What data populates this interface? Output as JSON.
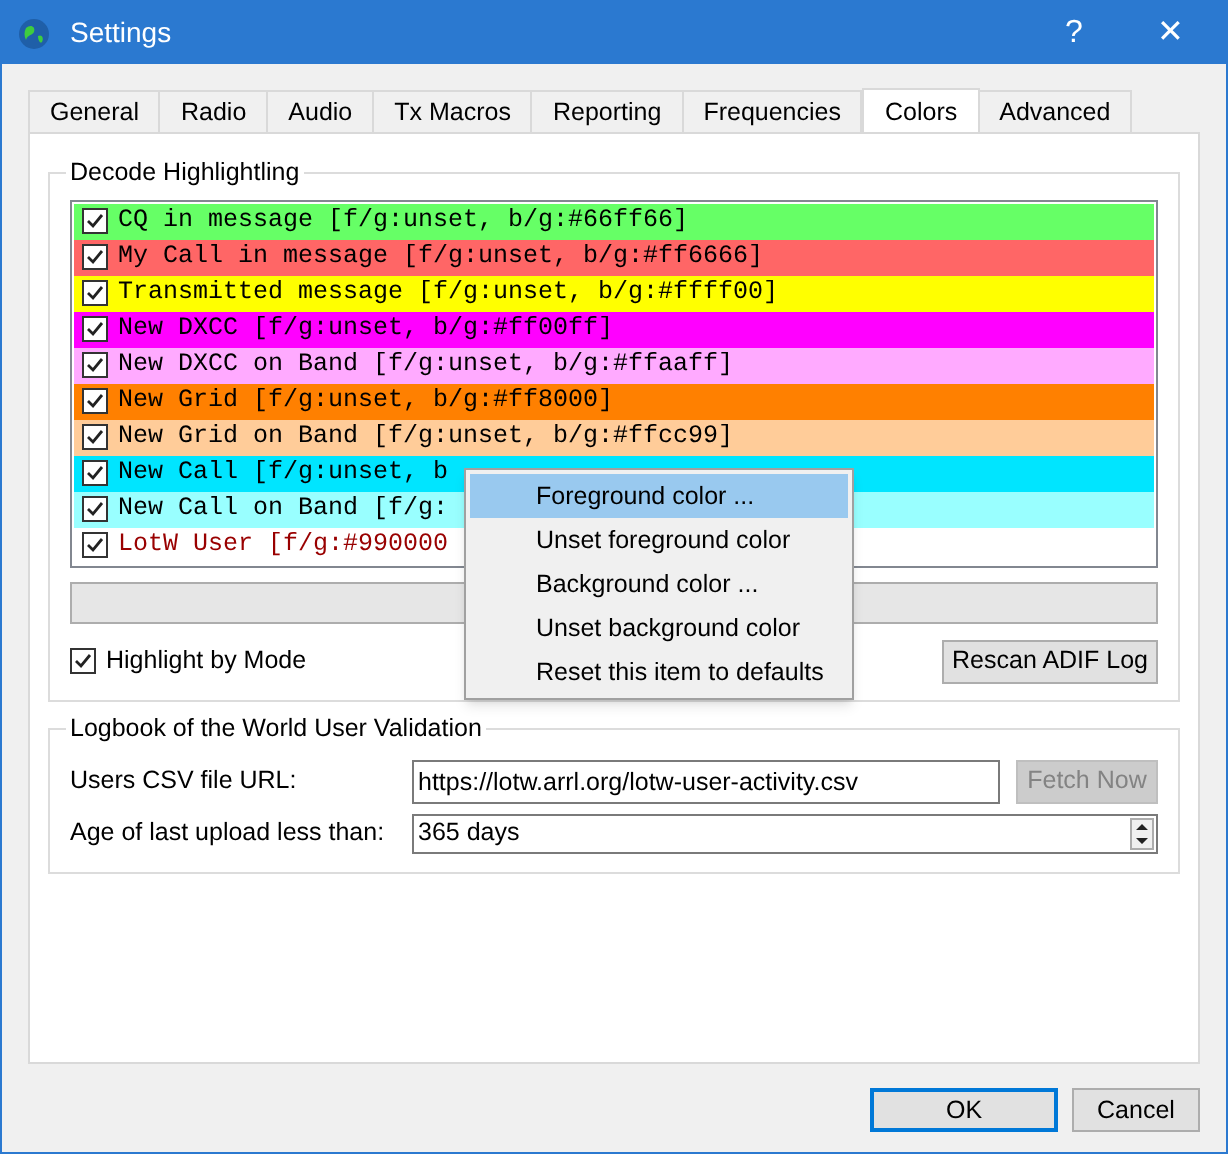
{
  "window": {
    "title": "Settings",
    "help": "?",
    "close": "✕"
  },
  "tabs": [
    {
      "label": "General",
      "selected": false
    },
    {
      "label": "Radio",
      "selected": false
    },
    {
      "label": "Audio",
      "selected": false
    },
    {
      "label": "Tx Macros",
      "selected": false
    },
    {
      "label": "Reporting",
      "selected": false
    },
    {
      "label": "Frequencies",
      "selected": false
    },
    {
      "label": "Colors",
      "selected": true
    },
    {
      "label": "Advanced",
      "selected": false
    }
  ],
  "decode_highlighting": {
    "title": "Decode Highlightling",
    "items": [
      {
        "label": "CQ in message [f/g:unset, b/g:#66ff66]",
        "checked": true,
        "color": "#66ff66"
      },
      {
        "label": "My Call in message [f/g:unset, b/g:#ff6666]",
        "checked": true,
        "color": "#ff6666"
      },
      {
        "label": "Transmitted message [f/g:unset, b/g:#ffff00]",
        "checked": true,
        "color": "#ffff00"
      },
      {
        "label": "New DXCC [f/g:unset, b/g:#ff00ff]",
        "checked": true,
        "color": "#ff00ff"
      },
      {
        "label": "New DXCC on Band [f/g:unset, b/g:#ffaaff]",
        "checked": true,
        "color": "#ffaaff"
      },
      {
        "label": "New Grid [f/g:unset, b/g:#ff8000]",
        "checked": true,
        "color": "#ff8000"
      },
      {
        "label": "New Grid on Band [f/g:unset, b/g:#ffcc99]",
        "checked": true,
        "color": "#ffcc99"
      },
      {
        "label": "New Call [f/g:unset, b",
        "checked": true,
        "color": "#00e5ff"
      },
      {
        "label": "New Call on Band [f/g:",
        "checked": true,
        "color": "#99ffff"
      },
      {
        "label": "LotW User [f/g:#990000",
        "checked": true,
        "color": "#ffffff",
        "foreground": {
          "color": "#990000"
        }
      }
    ],
    "highlight_by_mode": {
      "label": "Highlight by Mode",
      "checked": true
    },
    "rescan_button": "Rescan ADIF Log"
  },
  "context_menu": [
    {
      "label": "Foreground color ...",
      "selected": true
    },
    {
      "label": "Unset foreground color",
      "selected": false
    },
    {
      "label": "Background color ...",
      "selected": false
    },
    {
      "label": "Unset background color",
      "selected": false
    },
    {
      "label": "Reset this item to defaults",
      "selected": false
    }
  ],
  "lotw": {
    "title": "Logbook of the World User Validation",
    "url_label": "Users CSV file URL:",
    "url_value": "https://lotw.arrl.org/lotw-user-activity.csv",
    "fetch_button": {
      "label": "Fetch Now",
      "disabled": true
    },
    "age_label": "Age of last upload less than:",
    "age_value": "365 days"
  },
  "buttons": [
    "OK",
    "Cancel"
  ]
}
